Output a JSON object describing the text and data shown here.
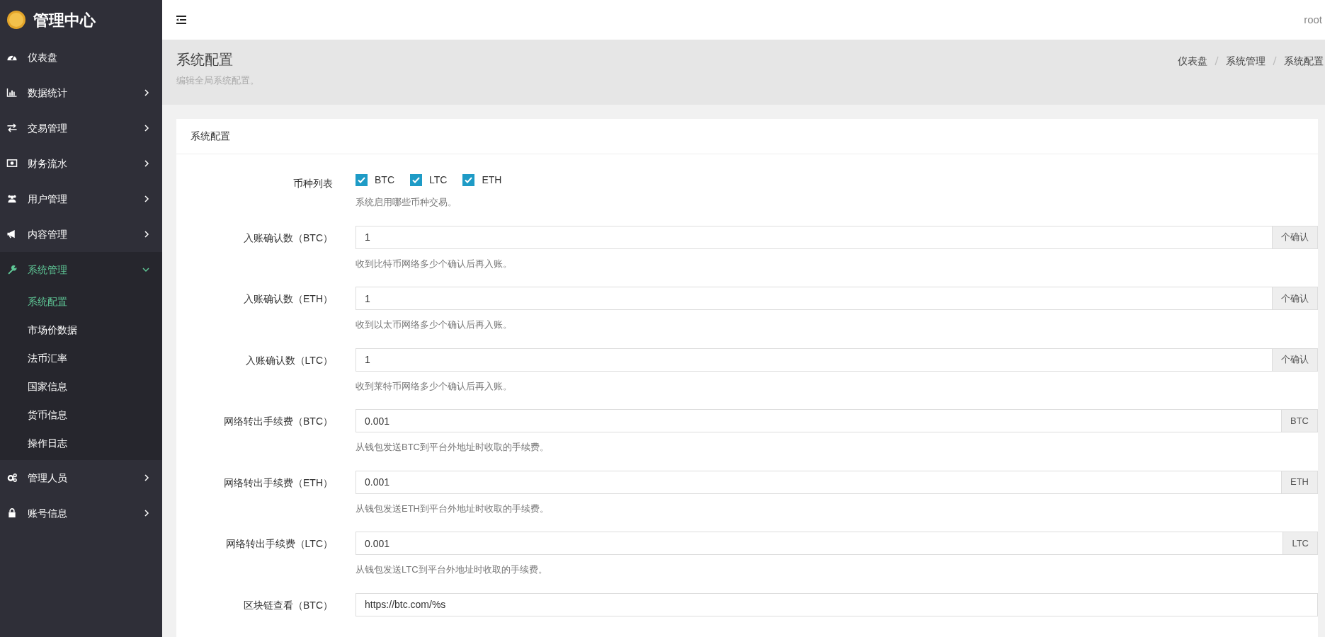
{
  "brand": {
    "title": "管理中心"
  },
  "sidebar": {
    "items": [
      {
        "label": "仪表盘",
        "kind": "link",
        "expanded": false
      },
      {
        "label": "数据统计",
        "kind": "group",
        "expanded": false
      },
      {
        "label": "交易管理",
        "kind": "group",
        "expanded": false
      },
      {
        "label": "财务流水",
        "kind": "group",
        "expanded": false
      },
      {
        "label": "用户管理",
        "kind": "group",
        "expanded": false
      },
      {
        "label": "内容管理",
        "kind": "group",
        "expanded": false
      },
      {
        "label": "系统管理",
        "kind": "group",
        "expanded": true,
        "children": [
          {
            "label": "系统配置",
            "selected": true
          },
          {
            "label": "市场价数据",
            "selected": false
          },
          {
            "label": "法币汇率",
            "selected": false
          },
          {
            "label": "国家信息",
            "selected": false
          },
          {
            "label": "货币信息",
            "selected": false
          },
          {
            "label": "操作日志",
            "selected": false
          }
        ]
      },
      {
        "label": "管理人员",
        "kind": "group",
        "expanded": false
      },
      {
        "label": "账号信息",
        "kind": "group",
        "expanded": false
      }
    ]
  },
  "topbar": {
    "user": "root"
  },
  "page_header": {
    "title": "系统配置",
    "subtitle": "编辑全局系统配置。",
    "breadcrumb": [
      "仪表盘",
      "系统管理",
      "系统配置"
    ]
  },
  "card": {
    "title": "系统配置",
    "fields": [
      {
        "kind": "checkboxes",
        "label": "币种列表",
        "options": [
          {
            "label": "BTC",
            "checked": true
          },
          {
            "label": "LTC",
            "checked": true
          },
          {
            "label": "ETH",
            "checked": true
          }
        ],
        "help": "系统启用哪些币种交易。"
      },
      {
        "kind": "input",
        "label": "入账确认数（BTC）",
        "value": "1",
        "addon": "个确认",
        "help": "收到比特币网络多少个确认后再入账。"
      },
      {
        "kind": "input",
        "label": "入账确认数（ETH）",
        "value": "1",
        "addon": "个确认",
        "help": "收到以太币网络多少个确认后再入账。"
      },
      {
        "kind": "input",
        "label": "入账确认数（LTC）",
        "value": "1",
        "addon": "个确认",
        "help": "收到莱特币网络多少个确认后再入账。"
      },
      {
        "kind": "input",
        "label": "网络转出手续费（BTC）",
        "value": "0.001",
        "addon": "BTC",
        "help": "从钱包发送BTC到平台外地址时收取的手续费。"
      },
      {
        "kind": "input",
        "label": "网络转出手续费（ETH）",
        "value": "0.001",
        "addon": "ETH",
        "help": "从钱包发送ETH到平台外地址时收取的手续费。"
      },
      {
        "kind": "input",
        "label": "网络转出手续费（LTC）",
        "value": "0.001",
        "addon": "LTC",
        "help": "从钱包发送LTC到平台外地址时收取的手续费。"
      },
      {
        "kind": "input",
        "label": "区块链查看（BTC）",
        "value": "https://btc.com/%s"
      }
    ]
  }
}
